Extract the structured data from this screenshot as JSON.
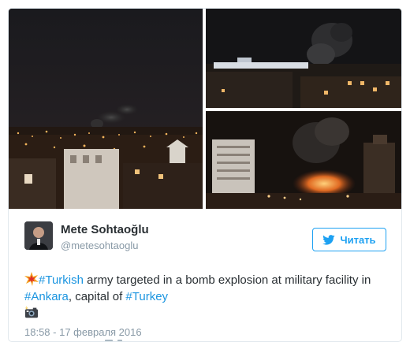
{
  "author": {
    "name": "Mete Sohtaoğlu",
    "handle": "@metesohtaoglu"
  },
  "follow_button": {
    "label": "Читать",
    "icon": "twitter-bird-icon"
  },
  "tweet": {
    "segments": [
      {
        "type": "emoji",
        "icon": "collision-emoji"
      },
      {
        "type": "hashtag",
        "text": "#Turkish"
      },
      {
        "type": "text",
        "text": " army targeted in a bomb explosion at military facility in "
      },
      {
        "type": "hashtag",
        "text": "#Ankara"
      },
      {
        "type": "text",
        "text": ", capital of "
      },
      {
        "type": "hashtag",
        "text": "#Turkey"
      }
    ],
    "trailing_icon": "camera-with-flash-emoji",
    "timestamp": "18:58 - 17 февраля 2016"
  },
  "media": [
    {
      "name": "photo-night-city-smoke",
      "icon": "photo"
    },
    {
      "name": "photo-smoke-over-buildings",
      "icon": "photo"
    },
    {
      "name": "photo-fire-at-street",
      "icon": "photo"
    }
  ],
  "colors": {
    "accent": "#1da1f2",
    "hashtag": "#1b95e0",
    "text": "#292f33",
    "muted": "#8899a6",
    "border": "#e1e8ed"
  }
}
